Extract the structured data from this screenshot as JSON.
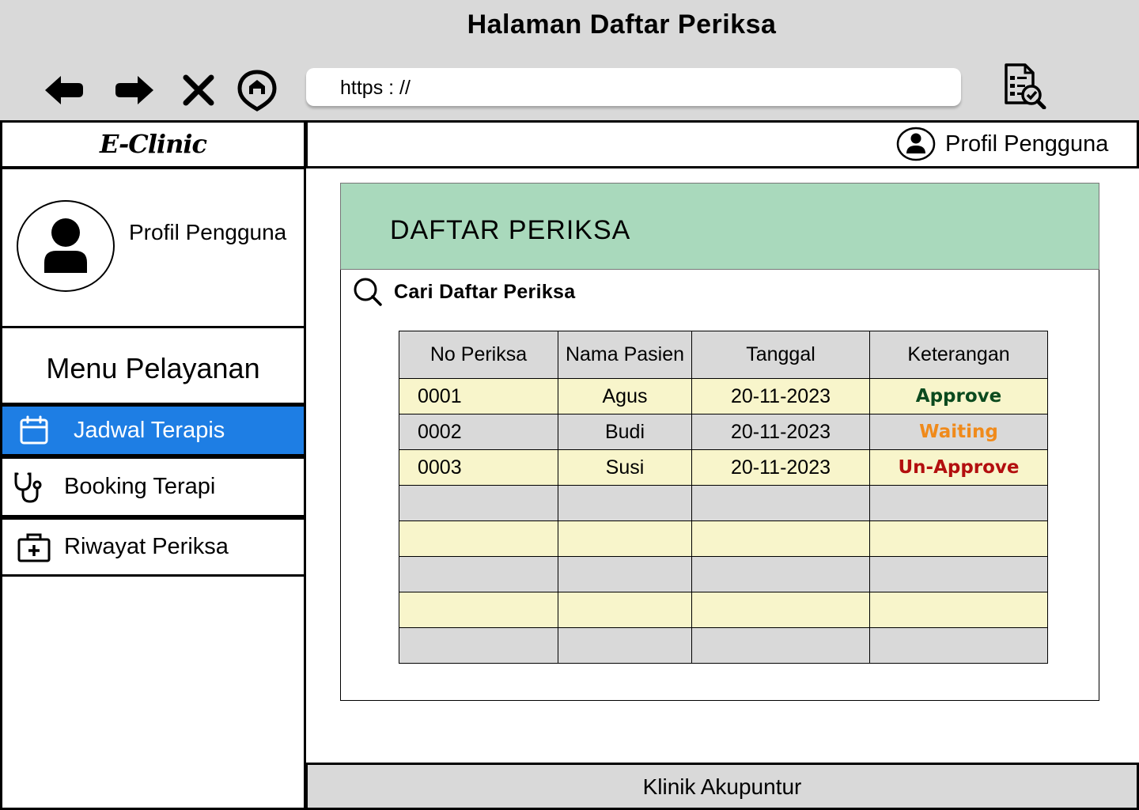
{
  "window": {
    "title": "Halaman Daftar Periksa"
  },
  "browser": {
    "url": "https :  //",
    "nav_icons": [
      "back-arrow-icon",
      "forward-arrow-icon",
      "close-x-icon",
      "home-icon"
    ],
    "action_icon": "document-check-icon"
  },
  "app": {
    "logo": "E-Clinic",
    "topbar_user": "Profil Pengguna",
    "footer": "Klinik Akupuntur"
  },
  "sidebar": {
    "profile_name": "Profil Pengguna",
    "menu_title": "Menu Pelayanan",
    "items": [
      {
        "label": "Jadwal Terapis",
        "icon": "calendar-icon",
        "active": true
      },
      {
        "label": "Booking Terapi",
        "icon": "stethoscope-icon",
        "active": false
      },
      {
        "label": "Riwayat Periksa",
        "icon": "medical-kit-icon",
        "active": false
      }
    ]
  },
  "main": {
    "title": "DAFTAR PERIKSA",
    "search_label": "Cari Daftar Periksa",
    "table": {
      "headers": [
        "No Periksa",
        "Nama Pasien",
        "Tanggal",
        "Keterangan"
      ],
      "rows": [
        {
          "no": "0001",
          "nama": "Agus",
          "tanggal": "20-11-2023",
          "keterangan": "Approve",
          "status_color": "#0b4a1e"
        },
        {
          "no": "0002",
          "nama": "Budi",
          "tanggal": "20-11-2023",
          "keterangan": "Waiting",
          "status_color": "#f08a1a"
        },
        {
          "no": "0003",
          "nama": "Susi",
          "tanggal": "20-11-2023",
          "keterangan": "Un-Approve",
          "status_color": "#b30f0f"
        }
      ],
      "empty_rows": 5
    }
  },
  "colors": {
    "chrome_bg": "#d9d9d9",
    "header_green": "#a9d9bc",
    "active_menu": "#1e7ee4",
    "row_yellow": "#f8f5cb",
    "row_gray": "#d9d9d9"
  }
}
